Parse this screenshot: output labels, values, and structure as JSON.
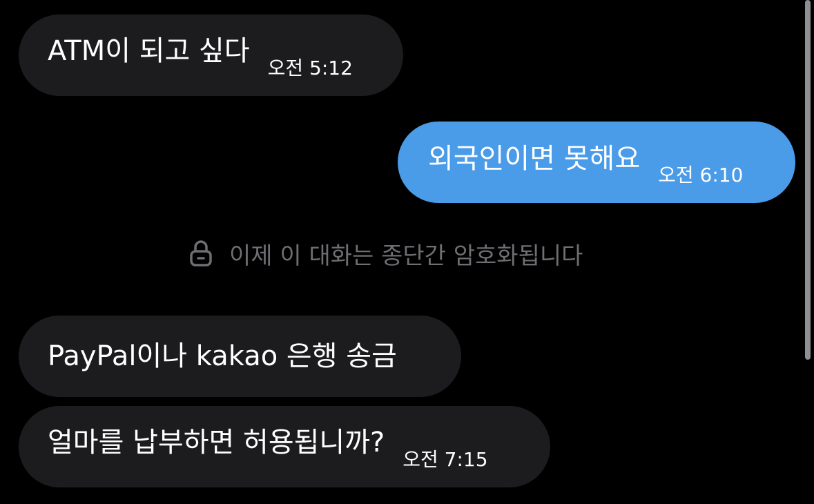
{
  "messages": [
    {
      "text": "ATM이 되고 싶다",
      "time": "오전 5:12",
      "sender": "other"
    },
    {
      "text": "외국인이면 못해요",
      "time": "오전 6:10",
      "sender": "me"
    },
    {
      "text": "PayPal이나 kakao 은행 송금",
      "time": "",
      "sender": "other"
    },
    {
      "text": "얼마를 납부하면 허용됩니까?",
      "time": "오전 7:15",
      "sender": "other"
    }
  ],
  "notice": {
    "icon": "lock-icon",
    "text": "이제 이 대화는 종단간 암호화됩니다"
  },
  "colors": {
    "background": "#000000",
    "incoming_bubble": "#1c1c1e",
    "outgoing_bubble": "#4a9be8",
    "notice_text": "#6e6e73"
  }
}
